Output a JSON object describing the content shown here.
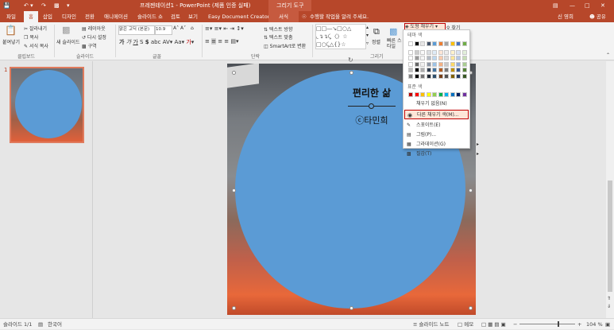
{
  "window": {
    "title": "프레젠테이션1 - PowerPoint (제품 인증 실패)",
    "context_title": "그리기 도구",
    "user": "신 영희",
    "share": "공유"
  },
  "tabs": [
    "파일",
    "홈",
    "삽입",
    "디자인",
    "전환",
    "애니메이션",
    "슬라이드 쇼",
    "검토",
    "보기",
    "Easy Document Creator",
    "서식"
  ],
  "tell_me": "수행할 작업을 알려 주세요.",
  "ribbon": {
    "groups": [
      "클립보드",
      "슬라이드",
      "글꼴",
      "단락",
      "그리기"
    ],
    "paste": "붙여넣기",
    "cut": "잘라내기",
    "copy": "복사",
    "format_painter": "서식 복사",
    "new_slide": "새 슬라이드",
    "layout": "레이아웃",
    "reset": "다시 설정",
    "section": "구역",
    "font_name": "맑은 고딕 (본문)",
    "font_size": "10.9",
    "text_direction": "텍스트 방향",
    "align_text": "텍스트 맞춤",
    "smartart": "SmartArt로 변환",
    "arrange": "정렬",
    "quick_styles": "빠른 스타일",
    "shape_fill": "도형 채우기",
    "find": "찾기"
  },
  "dropdown": {
    "theme_colors_label": "테마 색",
    "standard_colors_label": "표준 색",
    "no_fill": "채우기 없음(N)",
    "more_fill": "다른 채우기 색(M)...",
    "eyedropper": "스포이트(E)",
    "picture": "그림(P)...",
    "gradient": "그라데이션(G)",
    "texture": "질감(T)",
    "theme_top_row": [
      "#ffffff",
      "#000000",
      "#e7e6e6",
      "#44546a",
      "#5b9bd5",
      "#ed7d31",
      "#a5a5a5",
      "#ffc000",
      "#4472c4",
      "#70ad47"
    ],
    "standard_colors": [
      "#c00000",
      "#ff0000",
      "#ffc000",
      "#ffff00",
      "#92d050",
      "#00b050",
      "#00b0f0",
      "#0070c0",
      "#002060",
      "#7030a0"
    ]
  },
  "slide": {
    "title": "편리한 삶",
    "author": "ⓒ타민희",
    "circle_color": "#5b9bd5",
    "thumb_number": "1"
  },
  "status": {
    "slide_info": "슬라이드 1/1",
    "language": "한국어",
    "notes": "슬라이드 노트",
    "comments": "메모",
    "zoom": "104 %"
  },
  "colors": {
    "accent": "#b7472a",
    "highlight": "#c00000"
  }
}
